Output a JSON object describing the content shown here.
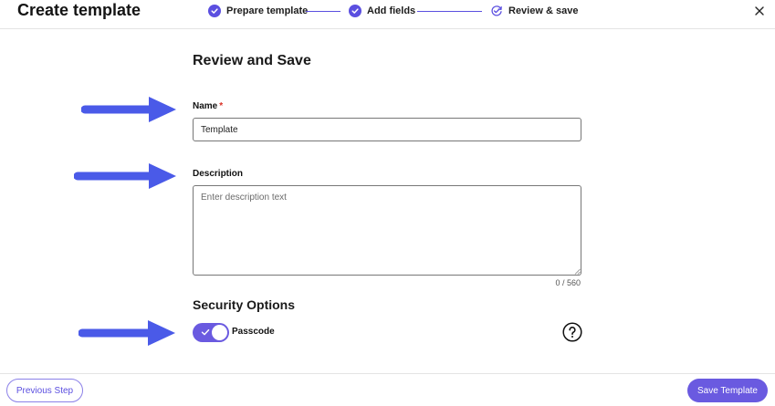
{
  "header": {
    "title": "Create template",
    "close_icon": "close-icon"
  },
  "stepper": {
    "steps": [
      {
        "label": "Prepare template",
        "status": "complete",
        "icon": "check-circle-icon"
      },
      {
        "label": "Add fields",
        "status": "complete",
        "icon": "check-circle-icon"
      },
      {
        "label": "Review & save",
        "status": "current",
        "icon": "refresh-check-icon"
      }
    ]
  },
  "form": {
    "section_title": "Review and Save",
    "name": {
      "label": "Name",
      "required_marker": "*",
      "value": "Template"
    },
    "description": {
      "label": "Description",
      "placeholder": "Enter description text",
      "value": "",
      "counter": "0 / 560"
    },
    "security": {
      "title": "Security Options",
      "passcode_label": "Passcode",
      "passcode_enabled": true,
      "help_icon": "question-circle-icon"
    }
  },
  "footer": {
    "previous_label": "Previous Step",
    "save_label": "Save Template"
  },
  "colors": {
    "accent": "#6a5ae0",
    "annotation_arrow": "#4a5ae8",
    "required": "#d93025"
  }
}
